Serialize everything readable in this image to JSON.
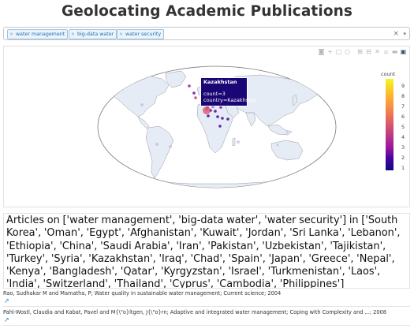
{
  "page": {
    "title": "Geolocating Academic Publications"
  },
  "filter": {
    "chips": [
      {
        "label": "water management"
      },
      {
        "label": "big-data water"
      },
      {
        "label": "water security"
      }
    ],
    "clear_glyph": "×",
    "caret_glyph": "▾"
  },
  "plot": {
    "modebar": [
      "camera-icon",
      "zoom-icon",
      "pan-icon",
      "lasso-icon",
      "zoom-in-icon",
      "zoom-out-icon",
      "reset-icon",
      "home-icon",
      "toggle-spikelines-icon",
      "plotly-logo"
    ],
    "hover": {
      "title": "Kazakhstan",
      "line1": "count=3",
      "line2": "country=Kazakhstan"
    },
    "colorbar": {
      "title": "count",
      "ticks": [
        "9",
        "8",
        "7",
        "6",
        "5",
        "4",
        "3",
        "2",
        "1"
      ],
      "colors": [
        "#f0f921",
        "#fdca26",
        "#fb9f3a",
        "#ed7953",
        "#d8576b",
        "#bd3786",
        "#9c179e",
        "#7201a8",
        "#46039f",
        "#0d0887"
      ]
    },
    "points": [
      {
        "country": "Kazakhstan",
        "count": 3
      }
    ]
  },
  "articles": {
    "heading": "Articles on ['water management', 'big-data water', 'water security'] in ['South Korea', 'Oman', 'Egypt', 'Afghanistan', 'Kuwait', 'Jordan', 'Sri Lanka', 'Lebanon', 'Ethiopia', 'China', 'Saudi Arabia', 'Iran', 'Pakistan', 'Uzbekistan', 'Tajikistan', 'Turkey', 'Syria', 'Kazakhstan', 'Iraq', 'Chad', 'Spain', 'Japan', 'Greece', 'Nepal', 'Kenya', 'Bangladesh', 'Qatar', 'Kyrgyzstan', 'Israel', 'Turkmenistan', 'Laos', 'India', 'Switzerland', 'Thailand', 'Cyprus', 'Cambodia', 'Philippines']",
    "entries": [
      {
        "citation": "Rao, Sudhakar M and Mamatha, P; Water quality in sustainable water management; Current science; 2004",
        "link_icon": "external-link-icon"
      },
      {
        "citation": "Pahl-Wostl, Claudia and Kabat, Pavel and M{\\\"o}ltgen, J{\\\"o}rn; Adaptive and integrated water management; Coping with Complexity and ...; 2008",
        "link_icon": "external-link-icon"
      }
    ]
  }
}
